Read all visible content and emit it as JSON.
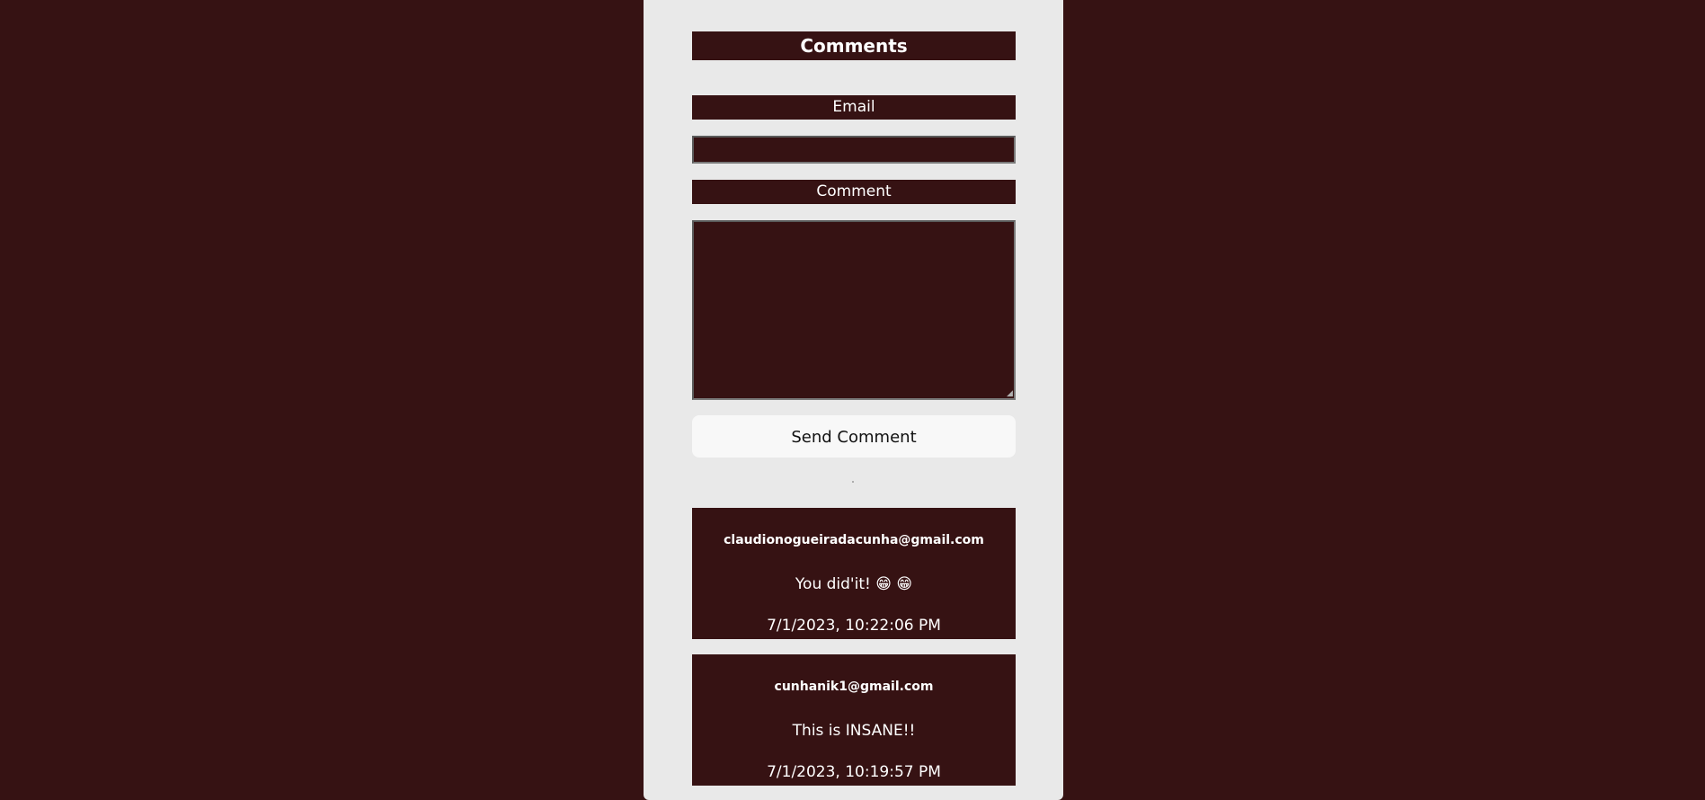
{
  "form": {
    "title": "Comments",
    "email_label": "Email",
    "email_value": "",
    "comment_label": "Comment",
    "comment_value": "",
    "send_label": "Send Comment"
  },
  "comments": [
    {
      "email": "claudionogueiradacunha@gmail.com",
      "text": "You did'it! 😁 😁",
      "date": "7/1/2023, 10:22:06 PM"
    },
    {
      "email": "cunhanik1@gmail.com",
      "text": "This is INSANE!!",
      "date": "7/1/2023, 10:19:57 PM"
    }
  ],
  "colors": {
    "background": "#361213",
    "panel": "#e9e9e9",
    "button": "#f8f8f8"
  }
}
